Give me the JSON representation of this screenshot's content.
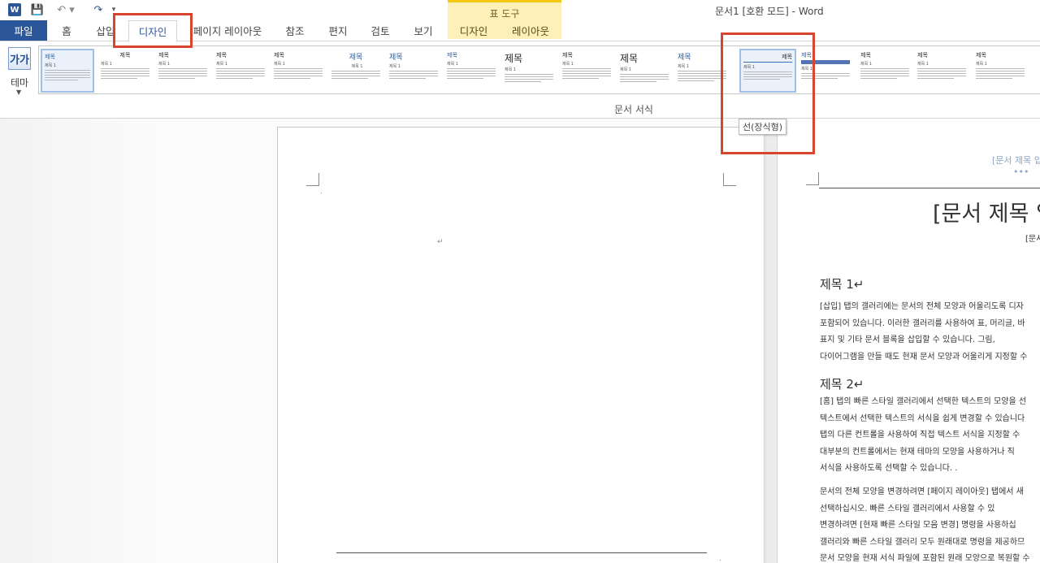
{
  "window": {
    "title": "문서1 [호환 모드] - Word"
  },
  "qat": {
    "word_icon": "W",
    "save_glyph": "💾",
    "undo_glyph": "↶ ▾",
    "redo_glyph": "↷",
    "more_glyph": "▾"
  },
  "contextual": {
    "title": "표 도구"
  },
  "tabs": {
    "file": "파일",
    "home": "홈",
    "insert": "삽입",
    "design": "디자인",
    "layout": "페이지 레이아웃",
    "refs": "참조",
    "mail": "편지",
    "review": "검토",
    "view": "보기",
    "table_design": "디자인",
    "table_layout": "레이아웃"
  },
  "ribbon": {
    "theme_icon_text": "가가",
    "theme_label": "테마",
    "group_label": "문서 서식",
    "gallery": [
      {
        "title": "제목",
        "heading": "제목 1"
      },
      {
        "title": "제목",
        "heading": "제목 1"
      },
      {
        "title": "제목",
        "heading": "제목 1"
      },
      {
        "title": "제목",
        "heading": "제목 1"
      },
      {
        "title": "제목",
        "heading": "제목 1"
      },
      {
        "title": "제목",
        "heading": "제목 1"
      },
      {
        "title": "제목",
        "heading": "제목 1"
      },
      {
        "title": "제목",
        "heading": "제목 1"
      },
      {
        "title": "제목",
        "heading": "제목 1"
      },
      {
        "title": "제목",
        "heading": "제목 1"
      },
      {
        "title": "제목",
        "heading": "제목 1"
      },
      {
        "title": "제목",
        "heading": "제목 1"
      },
      {
        "title": "제목",
        "heading": "제목 1"
      },
      {
        "title": "제목",
        "heading": "제목 1"
      },
      {
        "title": "제목",
        "heading": "제목 1"
      },
      {
        "title": "제목",
        "heading": "제목 1"
      },
      {
        "title": "제목",
        "heading": "제목 1"
      }
    ]
  },
  "tooltip": {
    "text": "선(장식형)"
  },
  "page1": {
    "para_mark_1": "↵",
    "para_mark_2": "↵",
    "end_mark": "."
  },
  "page2": {
    "header_title": "[문서 제목 입",
    "header_dots": "•••",
    "title": "[문서 제목 입",
    "subtitle": "[문서",
    "h1": "제목 1↵",
    "p1": [
      "[삽입] 탭의 갤러리에는 문서의 전체 모양과 어울리도록 디자",
      "포함되어 있습니다. 이러한 갤러리를 사용하여 표, 머리글, 바",
      "표지 및 기타 문서 블록을 삽입할 수 있습니다. 그림,",
      "다이어그램을 만들 때도 현재 문서 모양과 어울리게 지정할 수"
    ],
    "h2": "제목 2↵",
    "p2": [
      "[홈] 탭의 빠른 스타일 갤러리에서 선택한 텍스트의 모양을 선",
      "텍스트에서 선택한 텍스트의 서식을 쉽게 변경할 수 있습니다",
      "탭의 다른 컨트롤을 사용하여 직접 텍스트 서식을 지정할 수",
      "대부분의 컨트롤에서는 현재 테마의 모양을 사용하거나 직",
      "서식을 사용하도록 선택할 수 있습니다. ."
    ],
    "p3": [
      "문서의 전체 모양을 변경하려면 [페이지 레이아웃] 탭에서 새",
      "선택하십시오.  빠른 스타일 갤러리에서 사용할 수 있",
      "변경하려면 [현재 빠른 스타일 모음 변경] 명령을 사용하십",
      "갤러리와 빠른 스타일 갤러리 모두 원래대로 명령을 제공하므",
      "문서 모양을 현재 서식 파일에 포함된 원래 모양으로 복원할 수"
    ]
  },
  "colors": {
    "accent": "#2b579a",
    "contextual": "#fdf1b9",
    "highlight": "#d9442e"
  }
}
